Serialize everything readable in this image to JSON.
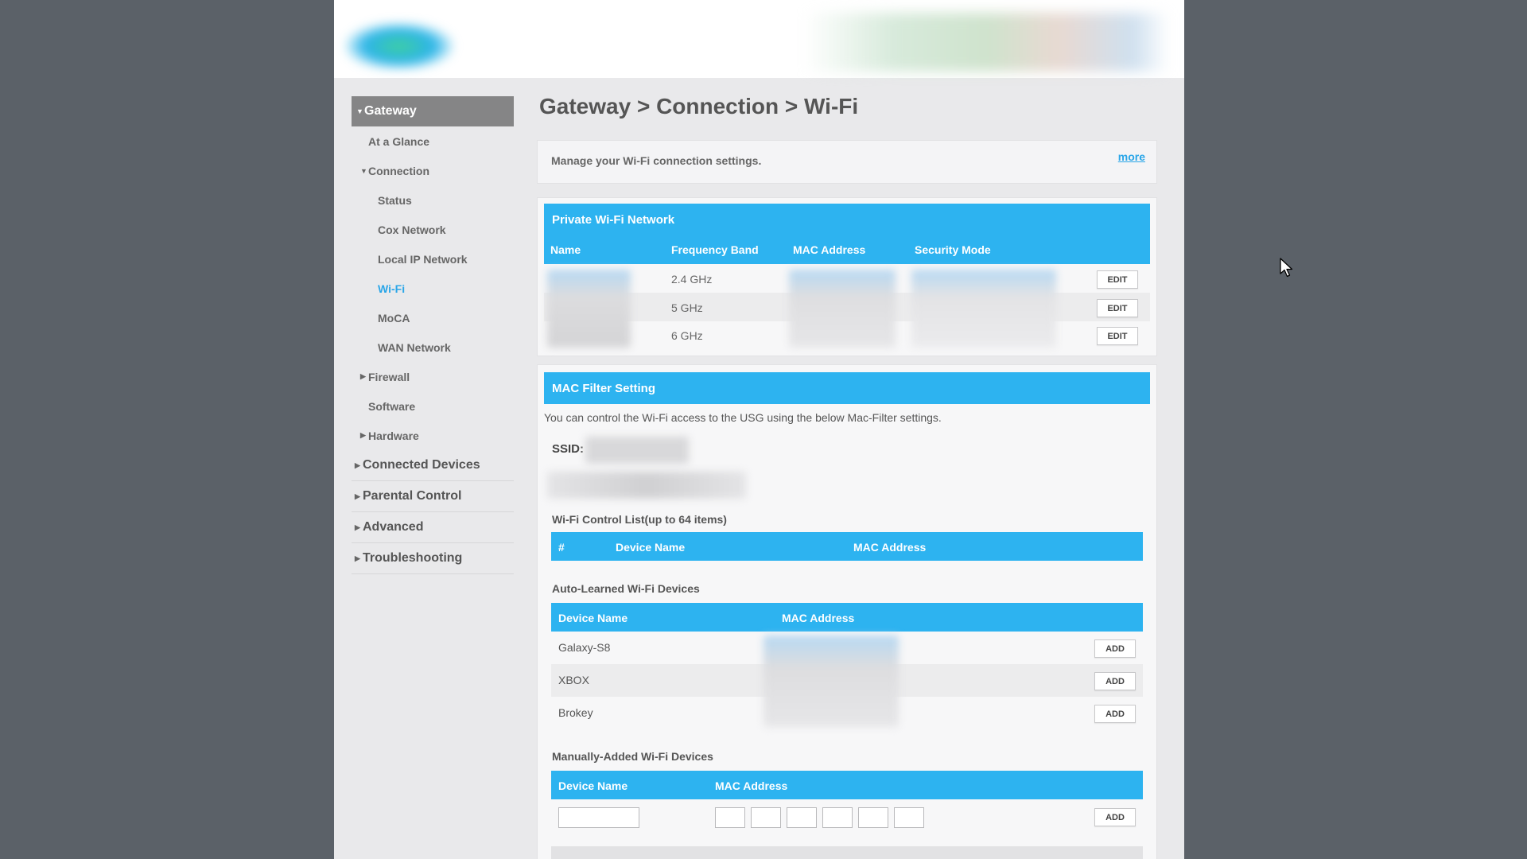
{
  "sidebar": {
    "gateway": "Gateway",
    "at_a_glance": "At a Glance",
    "connection": "Connection",
    "status": "Status",
    "cox_network": "Cox Network",
    "local_ip_network": "Local IP Network",
    "wifi": "Wi-Fi",
    "moca": "MoCA",
    "wan_network": "WAN Network",
    "firewall": "Firewall",
    "software": "Software",
    "hardware": "Hardware",
    "connected_devices": "Connected Devices",
    "parental_control": "Parental Control",
    "advanced": "Advanced",
    "troubleshooting": "Troubleshooting"
  },
  "page": {
    "title": "Gateway > Connection > Wi-Fi",
    "description": "Manage your Wi-Fi connection settings.",
    "more": "more"
  },
  "private_wifi": {
    "header": "Private Wi-Fi Network",
    "columns": {
      "name": "Name",
      "band": "Frequency Band",
      "mac": "MAC Address",
      "security": "Security Mode"
    },
    "rows": [
      {
        "band": "2.4 GHz",
        "action": "EDIT"
      },
      {
        "band": "5 GHz",
        "action": "EDIT"
      },
      {
        "band": "6 GHz",
        "action": "EDIT"
      }
    ]
  },
  "mac_filter": {
    "header": "MAC Filter Setting",
    "description": "You can control the Wi-Fi access to the USG using the below Mac-Filter settings.",
    "ssid_label": "SSID:",
    "control_list_title": "Wi-Fi Control List(up to 64 items)",
    "control_list_columns": {
      "num": "#",
      "device": "Device Name",
      "mac": "MAC Address"
    },
    "auto_learned_title": "Auto-Learned Wi-Fi Devices",
    "auto_learned_columns": {
      "device": "Device Name",
      "mac": "MAC Address"
    },
    "auto_learned_rows": [
      {
        "device": "Galaxy-S8",
        "action": "ADD"
      },
      {
        "device": "XBOX",
        "action": "ADD"
      },
      {
        "device": "Brokey",
        "action": "ADD"
      }
    ],
    "manual_title": "Manually-Added Wi-Fi Devices",
    "manual_columns": {
      "device": "Device Name",
      "mac": "MAC Address"
    },
    "manual_add": "ADD"
  },
  "colors": {
    "accent": "#2db3f0",
    "link": "#2aa6e8",
    "sidebar_active_bg": "#858586",
    "backdrop": "#5b6168"
  }
}
